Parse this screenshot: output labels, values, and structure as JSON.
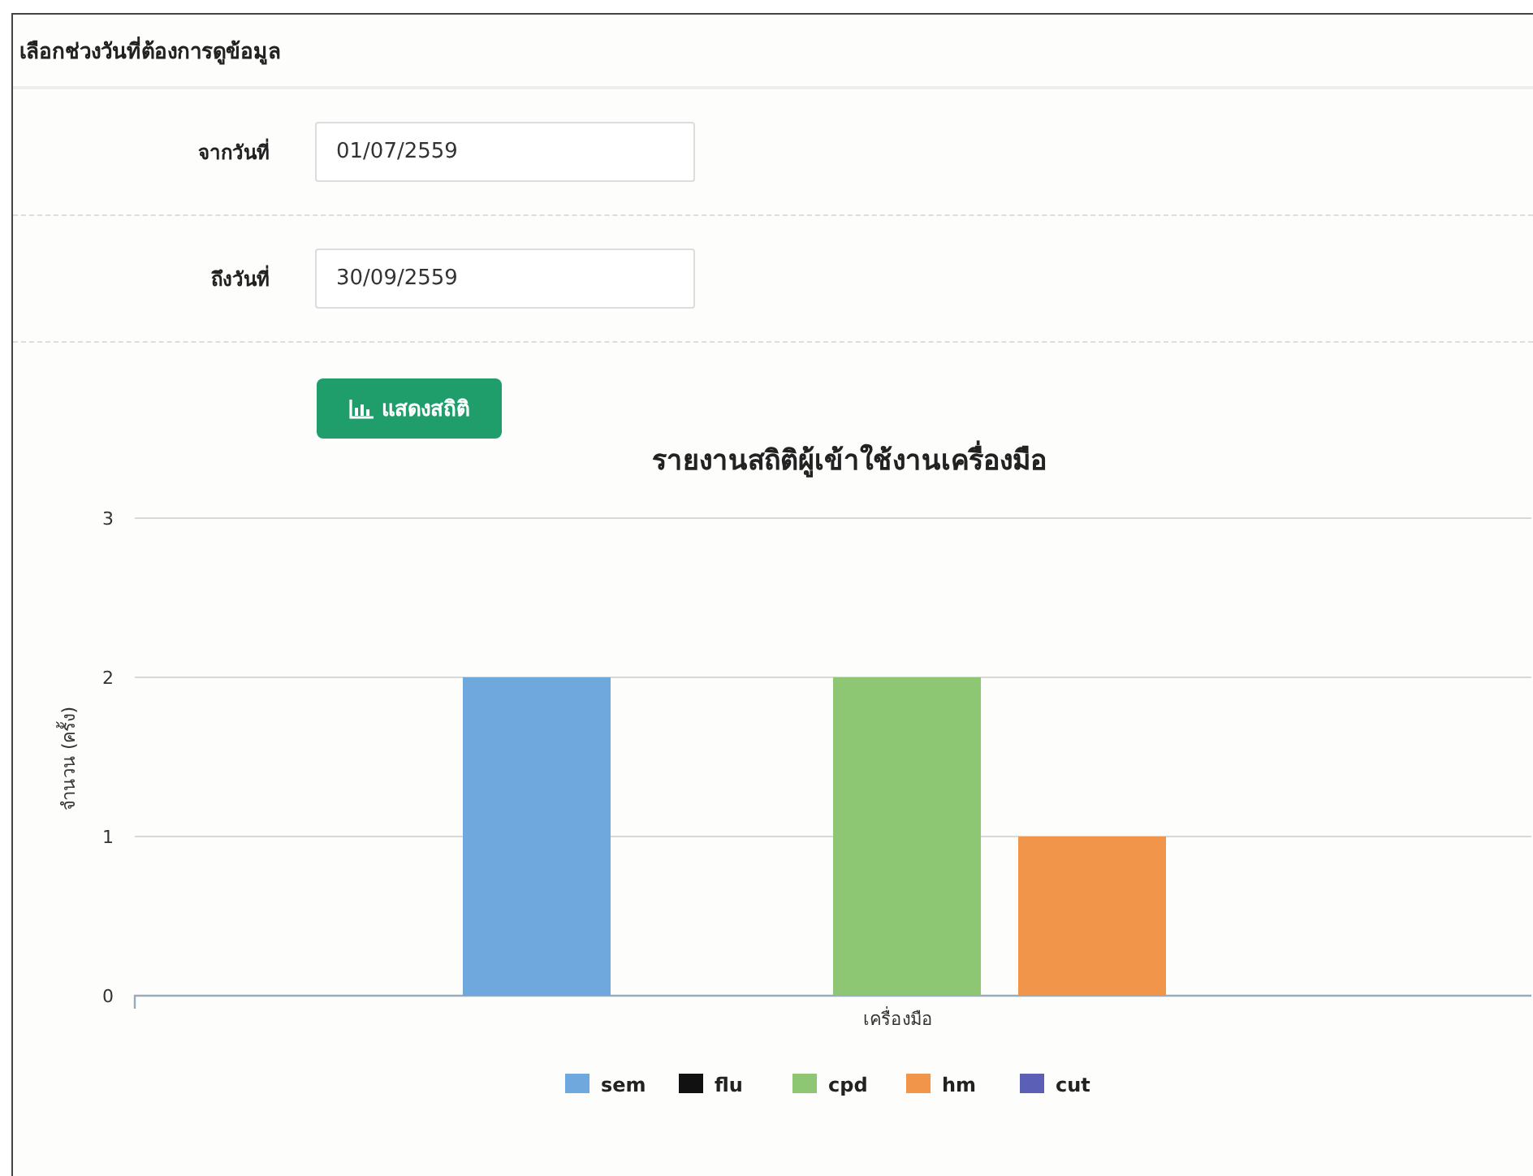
{
  "panel": {
    "title": "เลือกช่วงวันที่ต้องการดูข้อมูล"
  },
  "fields": [
    {
      "label": "จากวันที่",
      "value": "01/07/2559"
    },
    {
      "label": "ถึงวันที่",
      "value": "30/09/2559"
    }
  ],
  "button": {
    "label": "แสดงสถิติ"
  },
  "chart": {
    "chart_data": {
      "type": "bar",
      "title": "รายงานสถิติผู้เข้าใช้งานเครื่องมือ",
      "legend": true,
      "ylabel": "จำนวน (ครั้ง)",
      "categories": [
        "เครื่องมือ"
      ],
      "ylim": [
        0,
        3
      ],
      "yticks": [
        0,
        1,
        2,
        3
      ],
      "series": [
        {
          "name": "sem",
          "color": "#6fa8dc",
          "values": [
            2
          ]
        },
        {
          "name": "flu",
          "color": "#111111",
          "values": [
            0
          ]
        },
        {
          "name": "cpd",
          "color": "#8dc774",
          "values": [
            2
          ]
        },
        {
          "name": "hm",
          "color": "#f0954a",
          "values": [
            1
          ]
        },
        {
          "name": "cut",
          "color": "#5b5fb5",
          "values": [
            0
          ]
        }
      ]
    }
  }
}
